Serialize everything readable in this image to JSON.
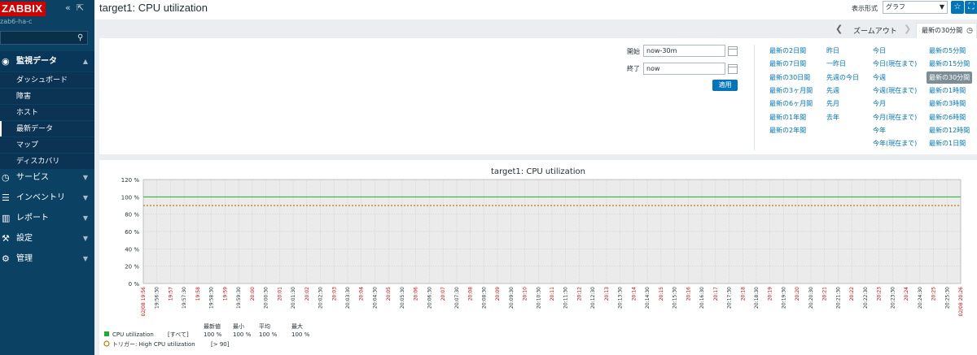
{
  "sidebar": {
    "logo": "ZABBIX",
    "server": "zab6-ha-c",
    "collapse_icon": "«",
    "kiosk_icon": "⇱",
    "menu": [
      {
        "label": "監視データ",
        "icon": "eye-icon",
        "glyph": "◉",
        "expanded": true
      },
      {
        "label": "サービス",
        "icon": "clock-icon",
        "glyph": "◷"
      },
      {
        "label": "インベントリ",
        "icon": "list-icon",
        "glyph": "☰"
      },
      {
        "label": "レポート",
        "icon": "bar-chart-icon",
        "glyph": "▥"
      },
      {
        "label": "設定",
        "icon": "wrench-icon",
        "glyph": "⚒"
      },
      {
        "label": "管理",
        "icon": "gear-icon",
        "glyph": "⚙"
      }
    ],
    "submenu": [
      "ダッシュボード",
      "障害",
      "ホスト",
      "最新データ",
      "マップ",
      "ディスカバリ"
    ]
  },
  "header": {
    "title": "target1: CPU utilization",
    "view_label": "表示形式",
    "view_value": "グラフ"
  },
  "zoombar": {
    "zoom_out": "ズームアウト",
    "active_tab": "最新の30分間"
  },
  "filter": {
    "from_label": "開始",
    "from_value": "now-30m",
    "to_label": "終了",
    "to_value": "now",
    "apply": "適用",
    "quick_cols": [
      [
        "最新の2日間",
        "最新の7日間",
        "最新の30日間",
        "最新の3ヶ月間",
        "最新の6ヶ月間",
        "最新の1年間",
        "最新の2年間"
      ],
      [
        "昨日",
        "一昨日",
        "先週の今日",
        "先週",
        "先月",
        "去年"
      ],
      [
        "今日",
        "今日(現在まで)",
        "今週",
        "今週(現在まで)",
        "今月",
        "今月(現在まで)",
        "今年",
        "今年(現在まで)"
      ],
      [
        "最新の5分間",
        "最新の15分間",
        "最新の30分間",
        "最新の1時間",
        "最新の3時間",
        "最新の6時間",
        "最新の12時間",
        "最新の1日間"
      ]
    ],
    "quick_selected": "最新の30分間"
  },
  "graph": {
    "legend": {
      "headers": [
        "最新値",
        "最小",
        "平均",
        "最大"
      ],
      "item_label": "CPU utilization",
      "item_scope": "[すべて]",
      "item_values": [
        "100 %",
        "100 %",
        "100 %",
        "100 %"
      ],
      "item_color": "#1aaf2f",
      "trigger_label": "トリガー: High CPU utilization",
      "trigger_cond": "[> 90]",
      "trigger_color": "#c07a00"
    }
  },
  "chart_data": {
    "type": "line",
    "title": "target1: CPU utilization",
    "y_ticks": [
      "120 %",
      "100 %",
      "80 %",
      "60 %",
      "40 %",
      "20 %",
      "0 %"
    ],
    "ylim": [
      0,
      120
    ],
    "grid": true,
    "x_start_label": "02/08 19:56",
    "x_end_label": "02/08 20:26",
    "x_labels": [
      "19:56:30",
      "19:57",
      "19:57:30",
      "19:58",
      "19:58:30",
      "19:59",
      "19:59:30",
      "20:00",
      "20:00:30",
      "20:01",
      "20:01:30",
      "20:02",
      "20:02:30",
      "20:03",
      "20:03:30",
      "20:04",
      "20:04:30",
      "20:05",
      "20:05:30",
      "20:06",
      "20:06:30",
      "20:07",
      "20:07:30",
      "20:08",
      "20:08:30",
      "20:09",
      "20:09:30",
      "20:10",
      "20:10:30",
      "20:11",
      "20:11:30",
      "20:12",
      "20:12:30",
      "20:13",
      "20:13:30",
      "20:14",
      "20:14:30",
      "20:15",
      "20:15:30",
      "20:16",
      "20:16:30",
      "20:17",
      "20:17:30",
      "20:18",
      "20:18:30",
      "20:19",
      "20:19:30",
      "20:20",
      "20:20:30",
      "20:21",
      "20:21:30",
      "20:22",
      "20:22:30",
      "20:23",
      "20:23:30",
      "20:24",
      "20:24:30",
      "20:25",
      "20:25:30"
    ],
    "series": [
      {
        "name": "CPU utilization",
        "color": "#1aaf2f",
        "x": [
          "02/08 19:56",
          "02/08 20:26"
        ],
        "y": [
          100,
          100
        ]
      }
    ],
    "threshold": {
      "name": "トリガー: High CPU utilization",
      "value": 90,
      "color": "#c07a00"
    }
  }
}
